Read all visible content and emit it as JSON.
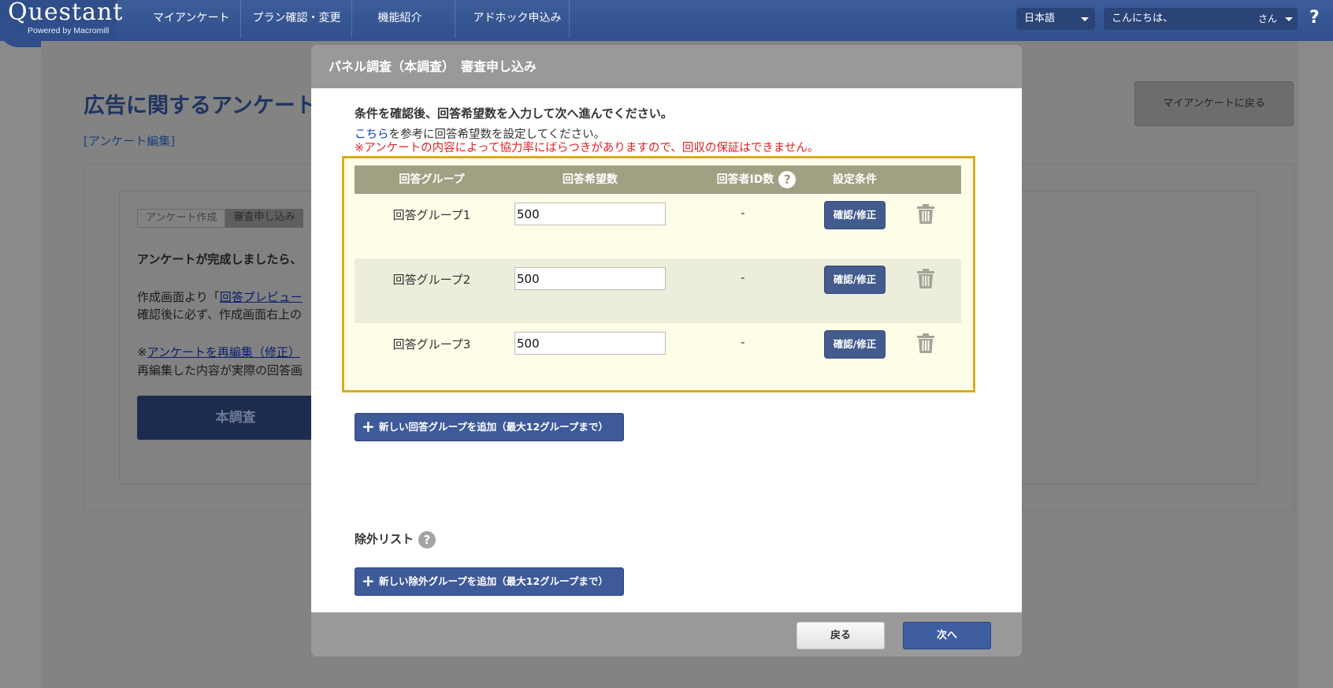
{
  "header": {
    "logo": "Questant",
    "logo_sub": "Powered by Macromill",
    "nav": [
      "マイアンケート",
      "プラン確認・変更",
      "機能紹介",
      "アドホック申込み"
    ],
    "language": "日本語",
    "greeting": "こんにちは、",
    "greeting_suffix": "さん",
    "help": "?"
  },
  "background": {
    "title": "広告に関するアンケート",
    "edit_link": "[アンケート編集]",
    "back_button": "マイアンケートに戻る",
    "steps": [
      "アンケート作成",
      "審査申し込み"
    ],
    "line1": "アンケートが完成しましたら、",
    "line2_prefix": "作成画面より「",
    "line2_link": "回答プレビュー",
    "line3": "確認後に必ず、作成画面右上の",
    "line4_prefix": "※",
    "line4_link": "アンケートを再編集（修正）",
    "line5": "再編集した内容が実際の回答画",
    "main_button": "本調査"
  },
  "modal": {
    "title": "パネル調査（本調査）　審査申し込み",
    "instruction": "条件を確認後、回答希望数を入力して次へ進んでください。",
    "ref_link": "こちら",
    "ref_text": "を参考に回答希望数を設定してください。",
    "warning": "※アンケートの内容によって協力率にばらつきがありますので、回収の保証はできません。",
    "table": {
      "headers": [
        "回答グループ",
        "回答希望数",
        "回答者ID数",
        "設定条件"
      ],
      "help_icon": "?",
      "rows": [
        {
          "group": "回答グループ1",
          "count": "500",
          "ids": "-",
          "button": "確認/修正"
        },
        {
          "group": "回答グループ2",
          "count": "500",
          "ids": "-",
          "button": "確認/修正"
        },
        {
          "group": "回答グループ3",
          "count": "500",
          "ids": "-",
          "button": "確認/修正"
        }
      ]
    },
    "add_group_button": "新しい回答グループを追加（最大12グループまで）",
    "exclude_label": "除外リスト",
    "exclude_help": "?",
    "add_exclude_button": "新しい除外グループを追加（最大12グループまで）",
    "back_button": "戻る",
    "next_button": "次へ"
  },
  "colors": {
    "header_bg": "#30508c",
    "accent": "#3e5a99",
    "highlight_border": "#d7ad1f",
    "warning": "#e52020"
  }
}
